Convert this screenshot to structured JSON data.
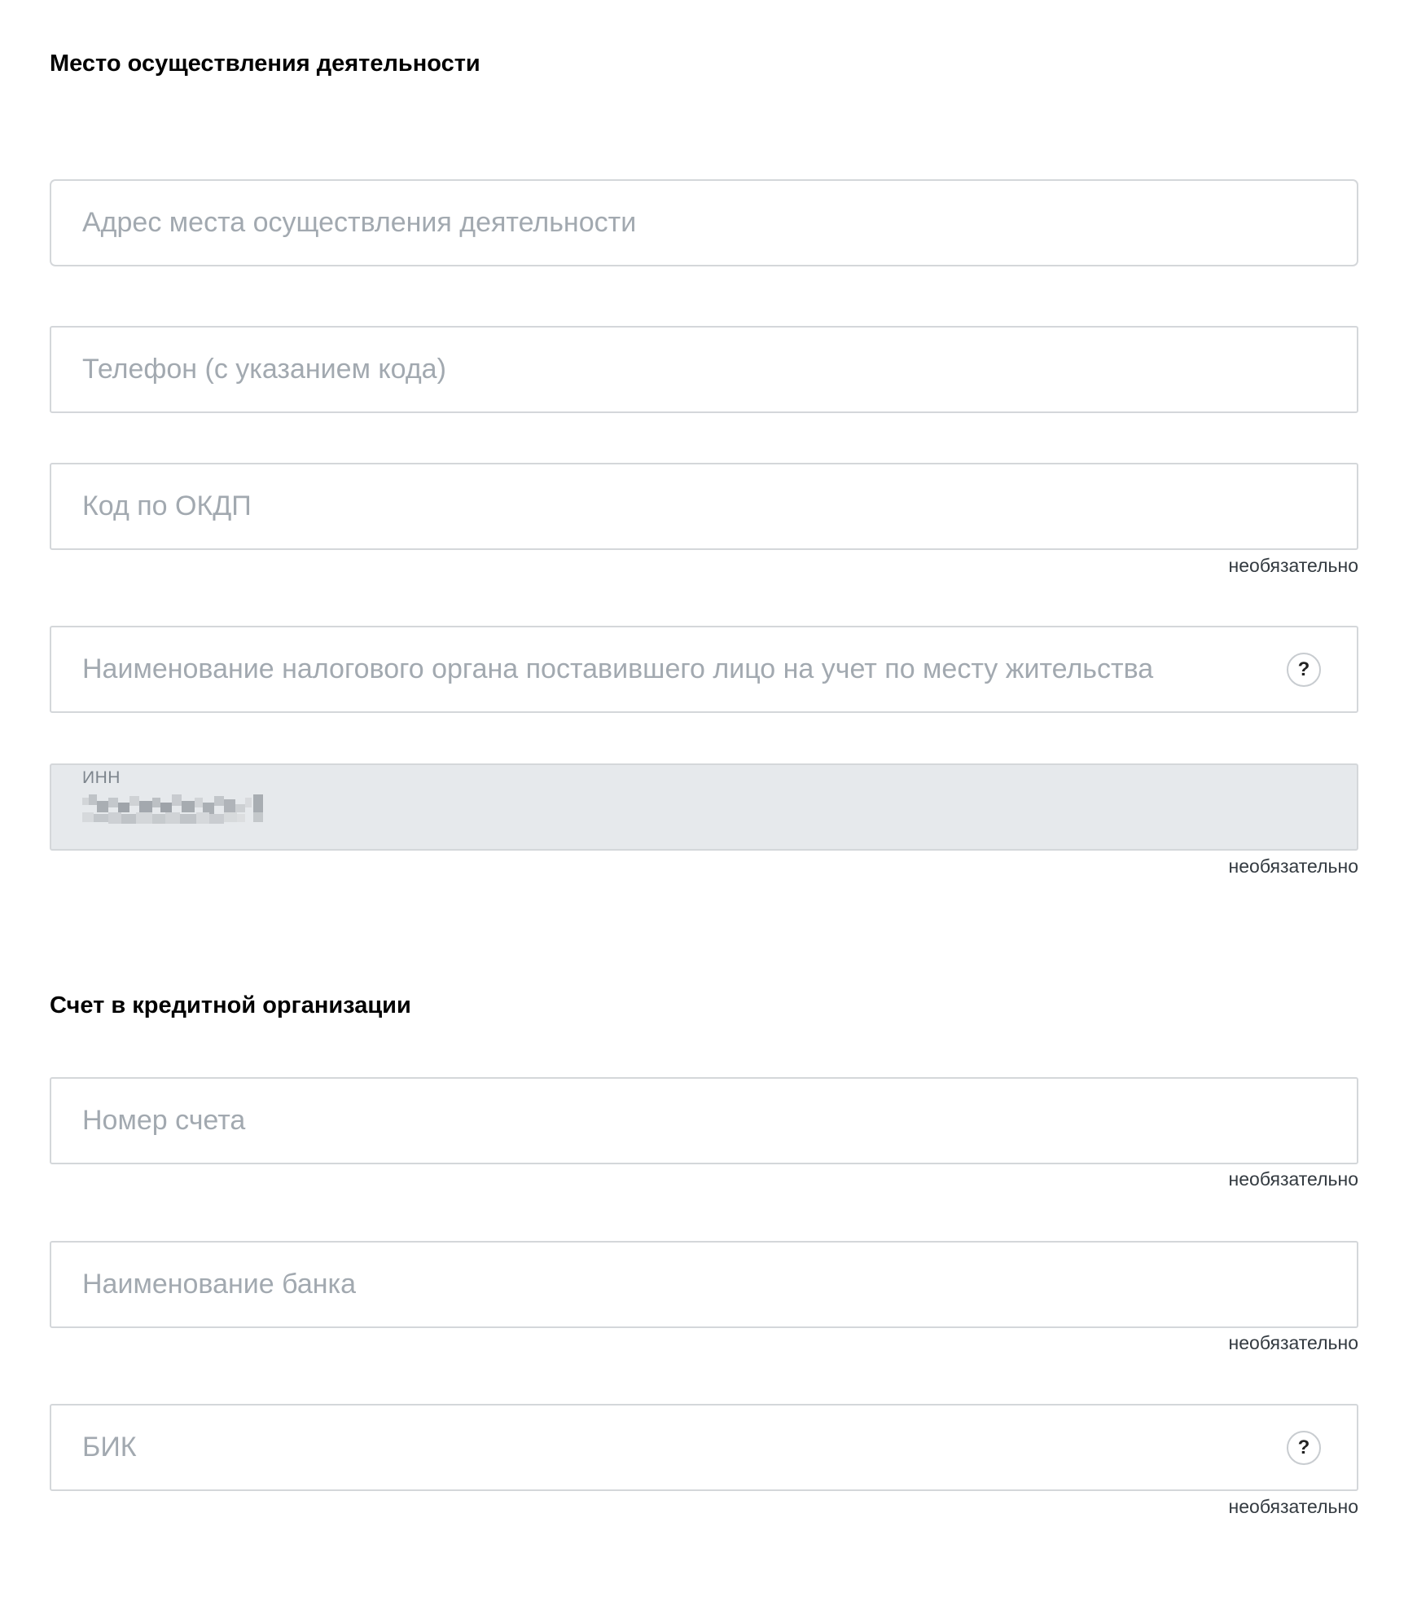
{
  "section_activity": {
    "title": "Место осуществления деятельности",
    "address": {
      "placeholder": "Адрес места осуществления деятельности",
      "value": ""
    },
    "phone": {
      "placeholder": "Телефон (с указанием кода)",
      "value": ""
    },
    "okdp": {
      "placeholder": "Код по ОКДП",
      "value": "",
      "hint": "необязательно"
    },
    "tax_authority": {
      "placeholder": "Наименование налогового органа поставившего лицо на учет по месту жительства",
      "value": "",
      "help": "?"
    },
    "inn": {
      "label": "ИНН",
      "value_icon": "redacted-value",
      "hint": "необязательно"
    }
  },
  "section_bank": {
    "title": "Счет в кредитной организации",
    "account": {
      "placeholder": "Номер счета",
      "value": "",
      "hint": "необязательно"
    },
    "bank_name": {
      "placeholder": "Наименование банка",
      "value": "",
      "hint": "необязательно"
    },
    "bik": {
      "placeholder": "БИК",
      "value": "",
      "help": "?",
      "hint": "необязательно"
    }
  },
  "colors": {
    "border": "#d4d7da",
    "placeholder": "#a2a9b0",
    "disabled_bg": "#e6e9ec",
    "hint_text": "#333a40"
  }
}
